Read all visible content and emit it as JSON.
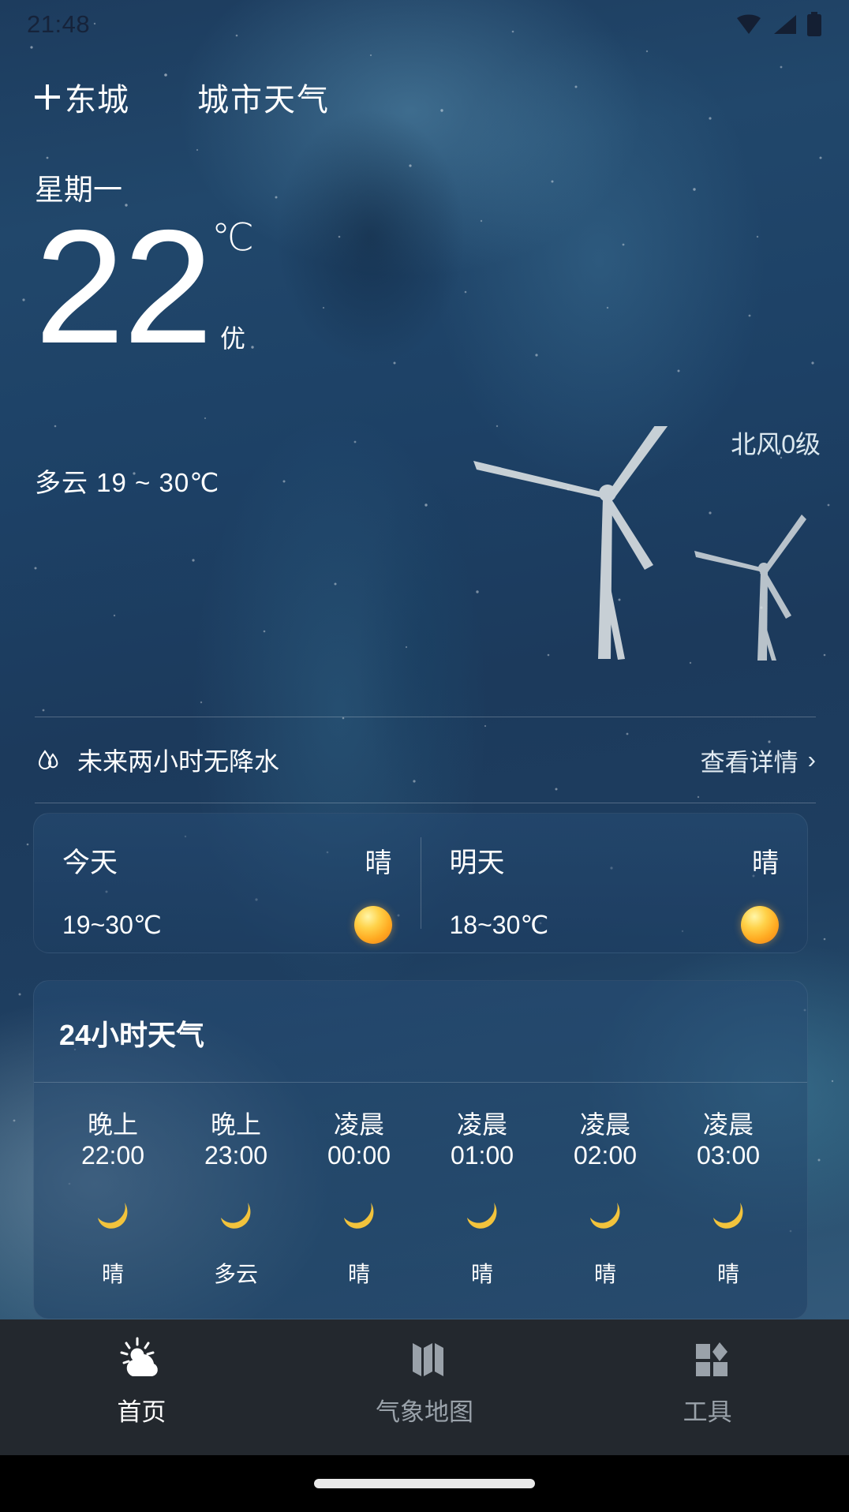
{
  "status_bar": {
    "time": "21:48",
    "icons": [
      "wifi-icon",
      "cellular-signal-icon",
      "battery-icon"
    ]
  },
  "header": {
    "add_icon": "plus-icon",
    "city": "东城",
    "title": "城市天气"
  },
  "current": {
    "weekday": "星期一",
    "temperature": "22",
    "unit": "℃",
    "air_quality": "优",
    "condition_range": "多云 19 ~ 30℃",
    "wind": "北风0级"
  },
  "precipitation": {
    "icon": "raindrop-icon",
    "text": "未来两小时无降水",
    "detail_label": "查看详情",
    "chevron": "›"
  },
  "two_day": [
    {
      "name": "今天",
      "condition": "晴",
      "range": "19~30℃",
      "icon": "sun-icon"
    },
    {
      "name": "明天",
      "condition": "晴",
      "range": "18~30℃",
      "icon": "sun-icon"
    }
  ],
  "hourly": {
    "title": "24小时天气",
    "items": [
      {
        "period": "晚上",
        "time": "22:00",
        "icon": "moon-icon",
        "condition": "晴"
      },
      {
        "period": "晚上",
        "time": "23:00",
        "icon": "moon-icon",
        "condition": "多云"
      },
      {
        "period": "凌晨",
        "time": "00:00",
        "icon": "moon-icon",
        "condition": "晴"
      },
      {
        "period": "凌晨",
        "time": "01:00",
        "icon": "moon-icon",
        "condition": "晴"
      },
      {
        "period": "凌晨",
        "time": "02:00",
        "icon": "moon-icon",
        "condition": "晴"
      },
      {
        "period": "凌晨",
        "time": "03:00",
        "icon": "moon-icon",
        "condition": "晴"
      }
    ]
  },
  "bottom_nav": [
    {
      "label": "首页",
      "icon": "sun-cloud-icon",
      "active": true
    },
    {
      "label": "气象地图",
      "icon": "map-icon",
      "active": false
    },
    {
      "label": "工具",
      "icon": "tools-grid-icon",
      "active": false
    }
  ],
  "colors": {
    "sky_top": "#21476b",
    "sky_bottom": "#33597a",
    "nav_background": "#23282e",
    "nav_active": "#ffffff",
    "nav_idle": "#9aa2aa",
    "sun": "#ffab22",
    "moon": "#ffd24a"
  }
}
